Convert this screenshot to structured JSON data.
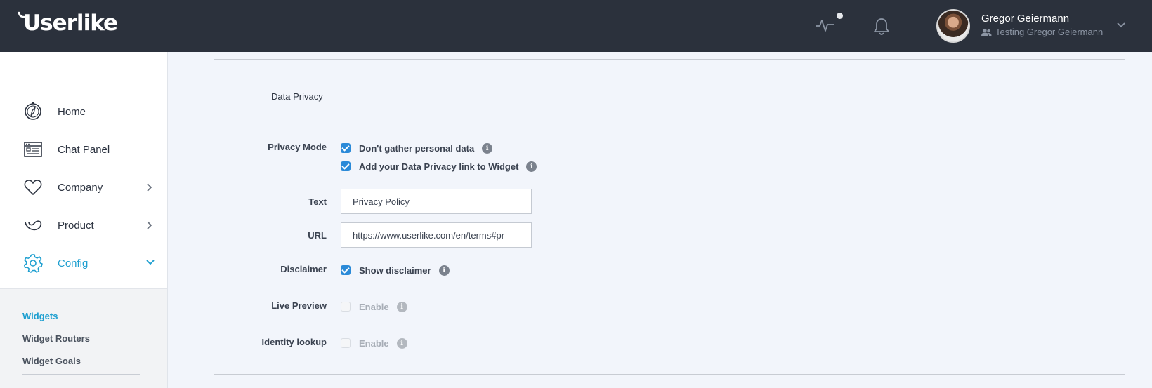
{
  "header": {
    "logo": "Userlike",
    "user_name": "Gregor Geiermann",
    "user_sub": "Testing Gregor Geiermann",
    "icons": [
      "activity-icon",
      "bell-icon",
      "user-group-icon",
      "chevron-down-icon"
    ]
  },
  "sidebar": {
    "items": [
      {
        "label": "Home",
        "icon": "compass-icon"
      },
      {
        "label": "Chat Panel",
        "icon": "chat-panel-icon"
      },
      {
        "label": "Company",
        "icon": "heart-icon"
      },
      {
        "label": "Product",
        "icon": "product-icon"
      },
      {
        "label": "Config",
        "icon": "gear-icon"
      }
    ],
    "subitems": [
      {
        "label": "Widgets"
      },
      {
        "label": "Widget Routers"
      },
      {
        "label": "Widget Goals"
      }
    ],
    "accent": "#1e9fd0"
  },
  "main": {
    "section_title": "Data Privacy",
    "privacy_mode": {
      "label": "Privacy Mode",
      "options": [
        {
          "label": "Don't gather personal data",
          "checked": true
        },
        {
          "label": "Add your Data Privacy link to Widget",
          "checked": true
        }
      ]
    },
    "text": {
      "label": "Text",
      "value": "Privacy Policy"
    },
    "url": {
      "label": "URL",
      "value": "https://www.userlike.com/en/terms#pr"
    },
    "disclaimer": {
      "label": "Disclaimer",
      "option": "Show disclaimer",
      "checked": true
    },
    "live_preview": {
      "label": "Live Preview",
      "option": "Enable",
      "checked": false
    },
    "identity_lookup": {
      "label": "Identity lookup",
      "option": "Enable",
      "checked": false
    },
    "info_glyph": "i"
  }
}
